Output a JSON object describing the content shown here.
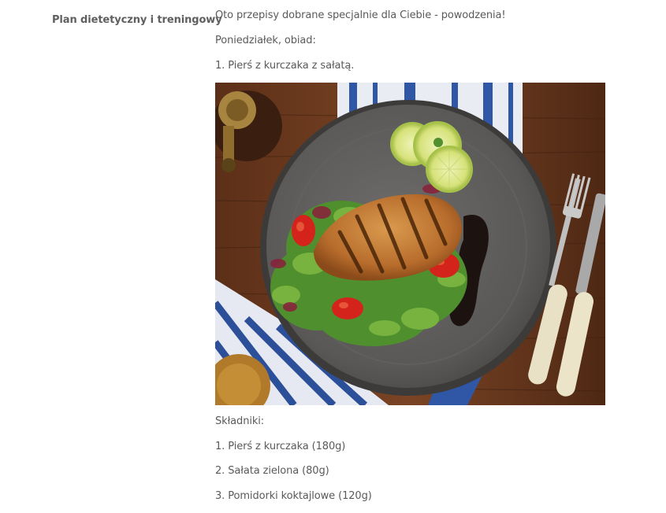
{
  "field": {
    "label": "Plan dietetyczny i treningowy"
  },
  "content": {
    "intro": "Oto przepisy dobrane specjalnie dla Ciebie - powodzenia!",
    "day_meal": "Poniedziałek, obiad:",
    "dish": "1. Pierś z kurczaka z sałatą.",
    "photo_icon": "grilled-chicken-salad-photo",
    "ingredients_heading": "Składniki:",
    "ingredients": [
      "1. Pierś z kurczaka (180g)",
      "2. Sałata zielona (80g)",
      "3. Pomidorki koktajlowe (120g)"
    ]
  },
  "colors": {
    "text": "#5a5a5a",
    "wood": "#6b3a1f",
    "plate": "#5e5d5c"
  }
}
